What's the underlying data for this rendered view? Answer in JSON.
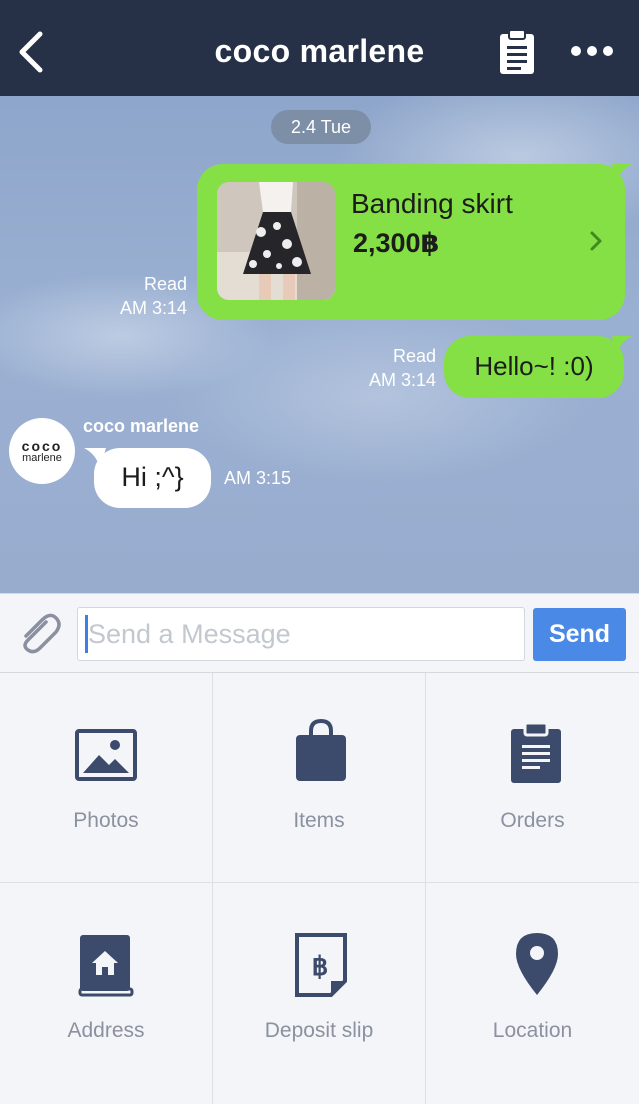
{
  "header": {
    "title": "coco marlene",
    "back_icon": "chevron-left-icon",
    "notes_icon": "clipboard-icon",
    "more_icon": "more-dots-icon"
  },
  "chat": {
    "date": "2.4 Tue",
    "messages": [
      {
        "type": "product",
        "from": "me",
        "product_name": "Banding skirt",
        "price": "2,300฿",
        "status": "Read",
        "time": "AM 3:14"
      },
      {
        "type": "text",
        "from": "me",
        "text": "Hello~! :0)",
        "status": "Read",
        "time": "AM 3:14"
      },
      {
        "type": "text",
        "from": "them",
        "sender": "coco marlene",
        "avatar_line1": "coco",
        "avatar_line2": "marlene",
        "text": "Hi ;^}",
        "time": "AM 3:15"
      }
    ]
  },
  "composer": {
    "placeholder": "Send a Message",
    "value": "",
    "send_label": "Send",
    "attach_icon": "paperclip-icon"
  },
  "menu": [
    {
      "label": "Photos",
      "icon": "photo-icon"
    },
    {
      "label": "Items",
      "icon": "shopping-bag-icon"
    },
    {
      "label": "Orders",
      "icon": "clipboard-list-icon"
    },
    {
      "label": "Address",
      "icon": "address-book-icon"
    },
    {
      "label": "Deposit slip",
      "icon": "deposit-slip-icon"
    },
    {
      "label": "Location",
      "icon": "location-pin-icon"
    }
  ],
  "colors": {
    "header_bg": "#263148",
    "my_bubble": "#84e045",
    "send_button": "#4a8ae6",
    "icon": "#3c4a6b"
  }
}
